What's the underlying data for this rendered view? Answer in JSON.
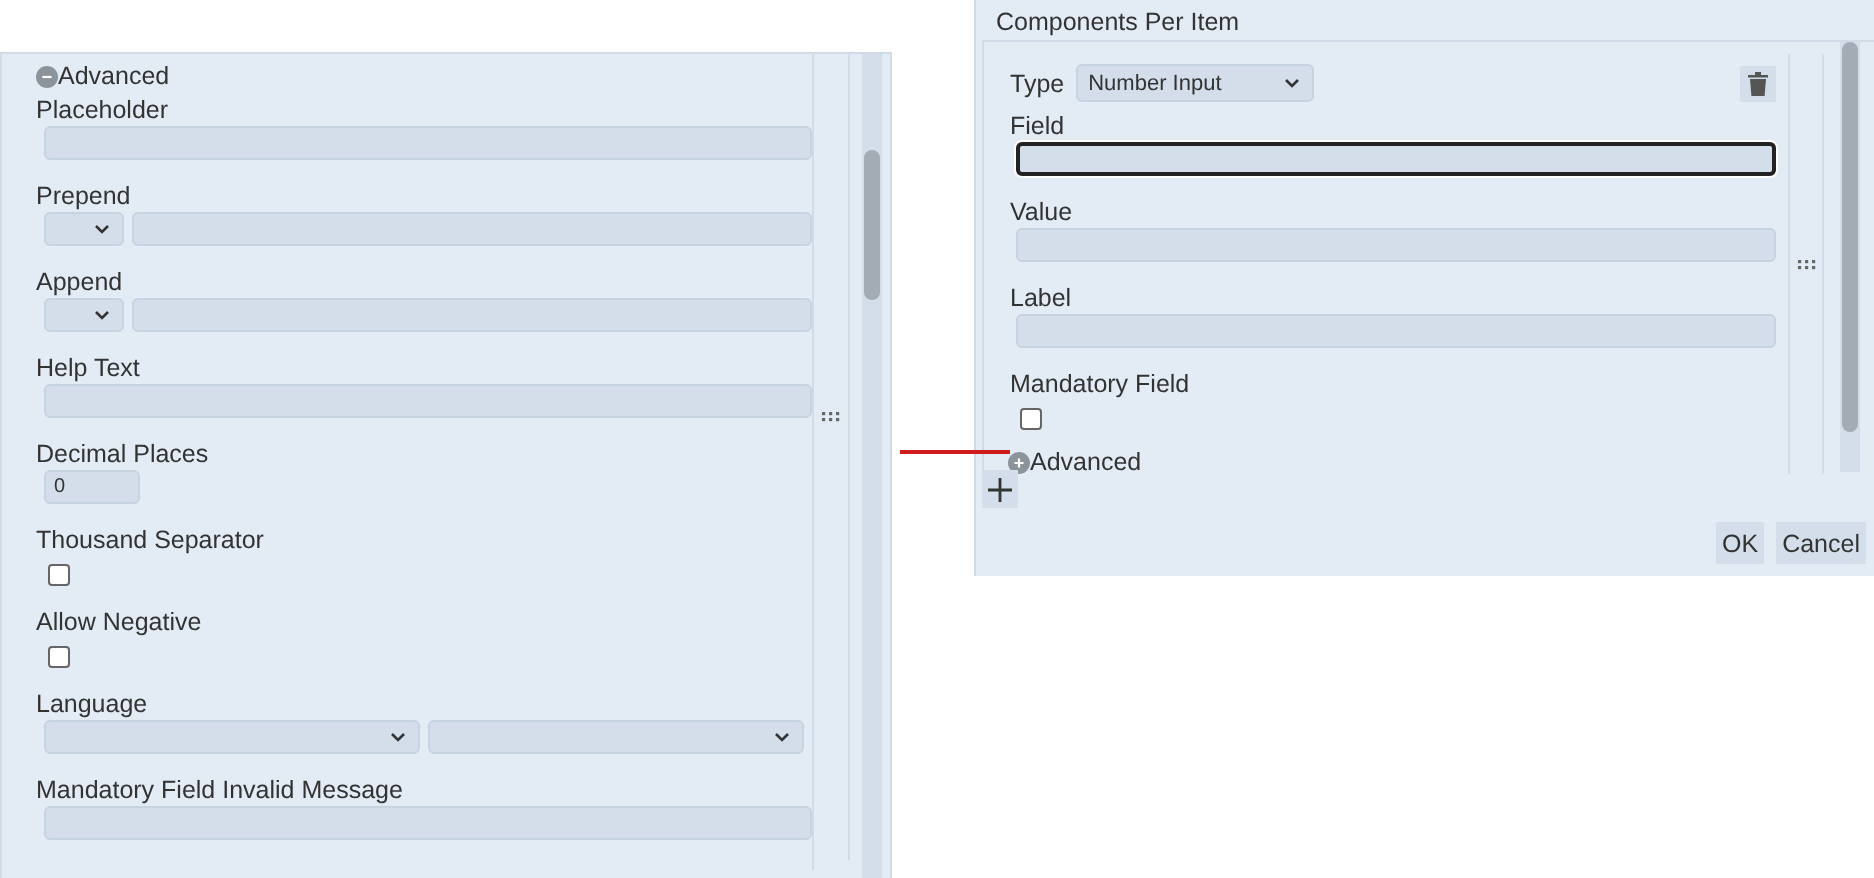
{
  "left_panel": {
    "advanced_toggle": {
      "label": "Advanced",
      "expanded": true
    },
    "fields": [
      {
        "kind": "text",
        "label": "Placeholder"
      },
      {
        "kind": "select_text",
        "label": "Prepend"
      },
      {
        "kind": "select_text",
        "label": "Append"
      },
      {
        "kind": "text",
        "label": "Help Text"
      },
      {
        "kind": "number",
        "label": "Decimal Places",
        "value": "0"
      },
      {
        "kind": "checkbox",
        "label": "Thousand Separator",
        "checked": false
      },
      {
        "kind": "checkbox",
        "label": "Allow Negative",
        "checked": false
      },
      {
        "kind": "two_selects",
        "label": "Language"
      },
      {
        "kind": "text",
        "label": "Mandatory Field Invalid Message"
      }
    ]
  },
  "dialog": {
    "title": "Components Per Item",
    "type": {
      "label": "Type",
      "value": "Number Input"
    },
    "fields": [
      {
        "kind": "text",
        "label": "Field",
        "focused": true
      },
      {
        "kind": "text",
        "label": "Value",
        "focused": false
      },
      {
        "kind": "text",
        "label": "Label",
        "focused": false
      },
      {
        "kind": "checkbox",
        "label": "Mandatory Field",
        "checked": false
      }
    ],
    "advanced_toggle": {
      "label": "Advanced",
      "expanded": false
    },
    "buttons": [
      "OK",
      "Cancel"
    ]
  }
}
